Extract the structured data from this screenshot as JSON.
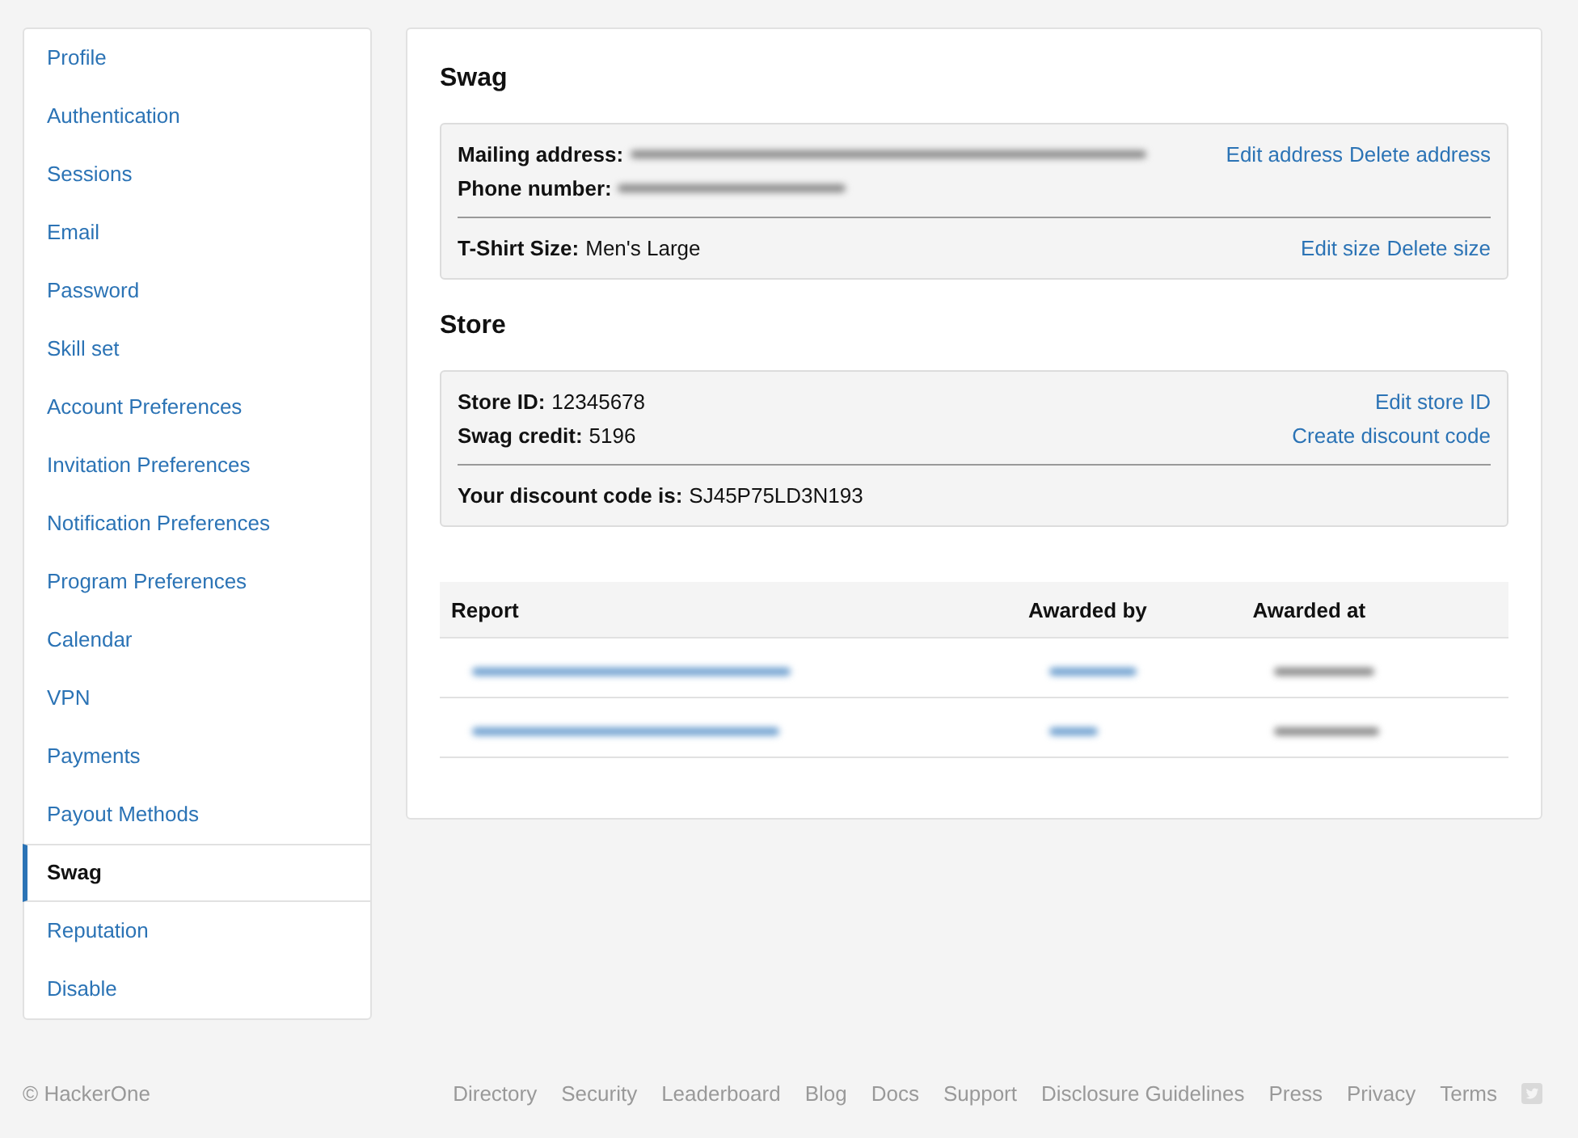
{
  "sidebar": {
    "items": [
      {
        "label": "Profile",
        "selected": false
      },
      {
        "label": "Authentication",
        "selected": false
      },
      {
        "label": "Sessions",
        "selected": false
      },
      {
        "label": "Email",
        "selected": false
      },
      {
        "label": "Password",
        "selected": false
      },
      {
        "label": "Skill set",
        "selected": false
      },
      {
        "label": "Account Preferences",
        "selected": false
      },
      {
        "label": "Invitation Preferences",
        "selected": false
      },
      {
        "label": "Notification Preferences",
        "selected": false
      },
      {
        "label": "Program Preferences",
        "selected": false
      },
      {
        "label": "Calendar",
        "selected": false
      },
      {
        "label": "VPN",
        "selected": false
      },
      {
        "label": "Payments",
        "selected": false
      },
      {
        "label": "Payout Methods",
        "selected": false
      },
      {
        "label": "Swag",
        "selected": true
      },
      {
        "label": "Reputation",
        "selected": false
      },
      {
        "label": "Disable",
        "selected": false
      }
    ]
  },
  "swag": {
    "title": "Swag",
    "fields": [
      {
        "label": "Mailing address:",
        "value": {
          "kind": "redacted"
        },
        "links": [
          "Edit address",
          "Delete address"
        ]
      },
      {
        "label": "Phone number:",
        "value": {
          "kind": "redacted"
        }
      }
    ],
    "footer_field": {
      "label": "T-Shirt Size:",
      "value": {
        "kind": "text",
        "text": "Men's Large"
      },
      "links": [
        "Edit size",
        "Delete size"
      ]
    }
  },
  "store": {
    "title": "Store",
    "fields": [
      {
        "label": "Store ID:",
        "value": {
          "kind": "text",
          "text": "12345678"
        },
        "links": [
          "Edit store ID"
        ]
      },
      {
        "label": "Swag credit:",
        "value": {
          "kind": "text",
          "text": "5196"
        },
        "links": [
          "Create discount code"
        ]
      }
    ],
    "footer_field": {
      "label": "Your discount code is:",
      "value": {
        "kind": "text",
        "text": "SJ45P75LD3N193"
      }
    }
  },
  "table": {
    "columns": [
      "Report",
      "Awarded by",
      "Awarded at"
    ],
    "rows": [
      {
        "cells": [
          {
            "kind": "redacted_link"
          },
          {
            "kind": "redacted_link"
          },
          {
            "kind": "redacted"
          }
        ]
      },
      {
        "cells": [
          {
            "kind": "redacted_link"
          },
          {
            "kind": "redacted_link"
          },
          {
            "kind": "redacted"
          }
        ]
      }
    ]
  },
  "footer": {
    "copyright": "© HackerOne",
    "links": [
      "Directory",
      "Security",
      "Leaderboard",
      "Blog",
      "Docs",
      "Support",
      "Disclosure Guidelines",
      "Press",
      "Privacy",
      "Terms"
    ]
  }
}
